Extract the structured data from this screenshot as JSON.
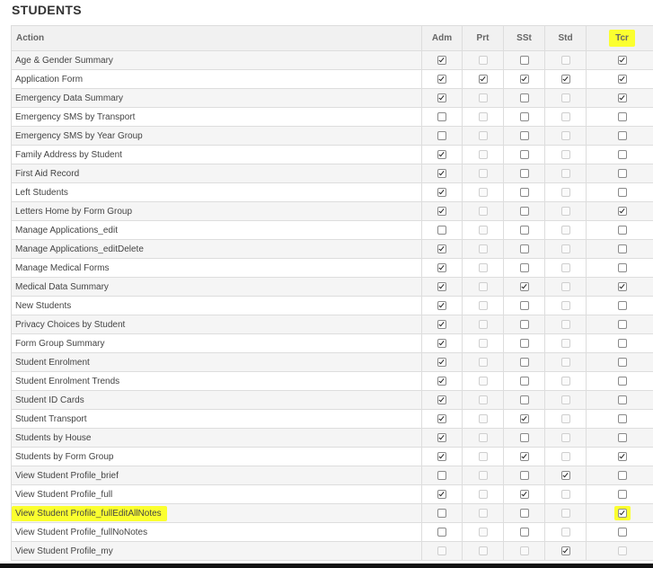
{
  "page": {
    "title": "STUDENTS"
  },
  "colors": {
    "highlight": "#fbff2f",
    "header_bg": "#f1f1f1",
    "row_alt_bg": "#f5f5f5",
    "border": "#dddddd"
  },
  "table": {
    "columns": [
      "Action",
      "Adm",
      "Prt",
      "SSt",
      "Std",
      "Tcr"
    ],
    "highlighted_column": "Tcr",
    "rows": [
      {
        "action": "Age & Gender Summary",
        "perms": [
          1,
          0,
          0,
          0,
          1
        ],
        "disabled": [
          0,
          1,
          0,
          1,
          0
        ]
      },
      {
        "action": "Application Form",
        "perms": [
          1,
          1,
          1,
          1,
          1
        ],
        "disabled": [
          0,
          0,
          0,
          0,
          0
        ]
      },
      {
        "action": "Emergency Data Summary",
        "perms": [
          1,
          0,
          0,
          0,
          1
        ],
        "disabled": [
          0,
          1,
          0,
          1,
          0
        ]
      },
      {
        "action": "Emergency SMS by Transport",
        "perms": [
          0,
          0,
          0,
          0,
          0
        ],
        "disabled": [
          0,
          1,
          0,
          1,
          0
        ]
      },
      {
        "action": "Emergency SMS by Year Group",
        "perms": [
          0,
          0,
          0,
          0,
          0
        ],
        "disabled": [
          0,
          1,
          0,
          1,
          0
        ]
      },
      {
        "action": "Family Address by Student",
        "perms": [
          1,
          0,
          0,
          0,
          0
        ],
        "disabled": [
          0,
          1,
          0,
          1,
          0
        ]
      },
      {
        "action": "First Aid Record",
        "perms": [
          1,
          0,
          0,
          0,
          0
        ],
        "disabled": [
          0,
          1,
          0,
          1,
          0
        ]
      },
      {
        "action": "Left Students",
        "perms": [
          1,
          0,
          0,
          0,
          0
        ],
        "disabled": [
          0,
          1,
          0,
          1,
          0
        ]
      },
      {
        "action": "Letters Home by Form Group",
        "perms": [
          1,
          0,
          0,
          0,
          1
        ],
        "disabled": [
          0,
          1,
          0,
          1,
          0
        ]
      },
      {
        "action": "Manage Applications_edit",
        "perms": [
          0,
          0,
          0,
          0,
          0
        ],
        "disabled": [
          0,
          1,
          0,
          1,
          0
        ]
      },
      {
        "action": "Manage Applications_editDelete",
        "perms": [
          1,
          0,
          0,
          0,
          0
        ],
        "disabled": [
          0,
          1,
          0,
          1,
          0
        ]
      },
      {
        "action": "Manage Medical Forms",
        "perms": [
          1,
          0,
          0,
          0,
          0
        ],
        "disabled": [
          0,
          1,
          0,
          1,
          0
        ]
      },
      {
        "action": "Medical Data Summary",
        "perms": [
          1,
          0,
          1,
          0,
          1
        ],
        "disabled": [
          0,
          1,
          0,
          1,
          0
        ]
      },
      {
        "action": "New Students",
        "perms": [
          1,
          0,
          0,
          0,
          0
        ],
        "disabled": [
          0,
          1,
          0,
          1,
          0
        ]
      },
      {
        "action": "Privacy Choices by Student",
        "perms": [
          1,
          0,
          0,
          0,
          0
        ],
        "disabled": [
          0,
          1,
          0,
          1,
          0
        ]
      },
      {
        "action": "Form Group Summary",
        "perms": [
          1,
          0,
          0,
          0,
          0
        ],
        "disabled": [
          0,
          1,
          0,
          1,
          0
        ]
      },
      {
        "action": "Student Enrolment",
        "perms": [
          1,
          0,
          0,
          0,
          0
        ],
        "disabled": [
          0,
          1,
          0,
          1,
          0
        ]
      },
      {
        "action": "Student Enrolment Trends",
        "perms": [
          1,
          0,
          0,
          0,
          0
        ],
        "disabled": [
          0,
          1,
          0,
          1,
          0
        ]
      },
      {
        "action": "Student ID Cards",
        "perms": [
          1,
          0,
          0,
          0,
          0
        ],
        "disabled": [
          0,
          1,
          0,
          1,
          0
        ]
      },
      {
        "action": "Student Transport",
        "perms": [
          1,
          0,
          1,
          0,
          0
        ],
        "disabled": [
          0,
          1,
          0,
          1,
          0
        ]
      },
      {
        "action": "Students by House",
        "perms": [
          1,
          0,
          0,
          0,
          0
        ],
        "disabled": [
          0,
          1,
          0,
          1,
          0
        ]
      },
      {
        "action": "Students by Form Group",
        "perms": [
          1,
          0,
          1,
          0,
          1
        ],
        "disabled": [
          0,
          1,
          0,
          1,
          0
        ]
      },
      {
        "action": "View Student Profile_brief",
        "perms": [
          0,
          0,
          0,
          1,
          0
        ],
        "disabled": [
          0,
          1,
          0,
          0,
          0
        ]
      },
      {
        "action": "View Student Profile_full",
        "perms": [
          1,
          0,
          1,
          0,
          0
        ],
        "disabled": [
          0,
          1,
          0,
          1,
          0
        ]
      },
      {
        "action": "View Student Profile_fullEditAllNotes",
        "perms": [
          0,
          0,
          0,
          0,
          1
        ],
        "disabled": [
          0,
          1,
          0,
          1,
          0
        ],
        "highlighted": true
      },
      {
        "action": "View Student Profile_fullNoNotes",
        "perms": [
          0,
          0,
          0,
          0,
          0
        ],
        "disabled": [
          0,
          1,
          0,
          1,
          0
        ]
      },
      {
        "action": "View Student Profile_my",
        "perms": [
          0,
          0,
          0,
          1,
          0
        ],
        "disabled": [
          1,
          1,
          1,
          0,
          1
        ]
      }
    ]
  }
}
